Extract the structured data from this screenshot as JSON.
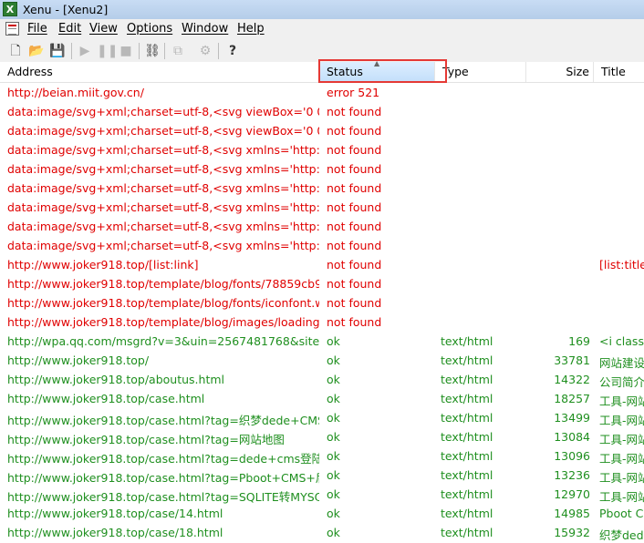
{
  "window": {
    "title": "Xenu - [Xenu2]",
    "app_icon": "x-logo-icon"
  },
  "menu": [
    "File",
    "Edit",
    "View",
    "Options",
    "Window",
    "Help"
  ],
  "toolbar": [
    "new-document-icon",
    "open-folder-icon",
    "save-icon",
    "play-icon",
    "pause-icon",
    "stop-icon",
    "binoculars-icon",
    "copy-icon",
    "properties-icon",
    "help-icon"
  ],
  "columns": {
    "address": "Address",
    "status": "Status",
    "type": "Type",
    "size": "Size",
    "title": "Title"
  },
  "rows": [
    {
      "address": "http://beian.miit.gov.cn/",
      "status": "error 521",
      "type": "",
      "size": "",
      "title": "",
      "color": "red"
    },
    {
      "address": "data:image/svg+xml;charset=utf-8,<svg viewBox='0 0 1...",
      "status": "not found",
      "type": "",
      "size": "",
      "title": "",
      "color": "red"
    },
    {
      "address": "data:image/svg+xml;charset=utf-8,<svg viewBox='0 0 1...",
      "status": "not found",
      "type": "",
      "size": "",
      "title": "",
      "color": "red"
    },
    {
      "address": "data:image/svg+xml;charset=utf-8,<svg xmlns='http://w...",
      "status": "not found",
      "type": "",
      "size": "",
      "title": "",
      "color": "red"
    },
    {
      "address": "data:image/svg+xml;charset=utf-8,<svg xmlns='http://w...",
      "status": "not found",
      "type": "",
      "size": "",
      "title": "",
      "color": "red"
    },
    {
      "address": "data:image/svg+xml;charset=utf-8,<svg xmlns='http://w...",
      "status": "not found",
      "type": "",
      "size": "",
      "title": "",
      "color": "red"
    },
    {
      "address": "data:image/svg+xml;charset=utf-8,<svg xmlns='http://w...",
      "status": "not found",
      "type": "",
      "size": "",
      "title": "",
      "color": "red"
    },
    {
      "address": "data:image/svg+xml;charset=utf-8,<svg xmlns='http://w...",
      "status": "not found",
      "type": "",
      "size": "",
      "title": "",
      "color": "red"
    },
    {
      "address": "data:image/svg+xml;charset=utf-8,<svg xmlns='http://w...",
      "status": "not found",
      "type": "",
      "size": "",
      "title": "",
      "color": "red"
    },
    {
      "address": "http://www.joker918.top/[list:link]",
      "status": "not found",
      "type": "",
      "size": "",
      "title": "[list:title]",
      "color": "red"
    },
    {
      "address": "http://www.joker918.top/template/blog/fonts/78859cb9...",
      "status": "not found",
      "type": "",
      "size": "",
      "title": "",
      "color": "red"
    },
    {
      "address": "http://www.joker918.top/template/blog/fonts/iconfont.woff",
      "status": "not found",
      "type": "",
      "size": "",
      "title": "",
      "color": "red"
    },
    {
      "address": "http://www.joker918.top/template/blog/images/loading.gif",
      "status": "not found",
      "type": "",
      "size": "",
      "title": "",
      "color": "red"
    },
    {
      "address": "http://wpa.qq.com/msgrd?v=3&uin=2567481768&site=...",
      "status": "ok",
      "type": "text/html",
      "size": "169",
      "title": " <i class",
      "color": "green"
    },
    {
      "address": "http://www.joker918.top/",
      "status": "ok",
      "type": "text/html",
      "size": "33781",
      "title": "网站建设",
      "color": "green"
    },
    {
      "address": "http://www.joker918.top/aboutus.html",
      "status": "ok",
      "type": "text/html",
      "size": "14322",
      "title": "公司简介",
      "color": "green"
    },
    {
      "address": "http://www.joker918.top/case.html",
      "status": "ok",
      "type": "text/html",
      "size": "18257",
      "title": "工具-网站",
      "color": "green"
    },
    {
      "address": "http://www.joker918.top/case.html?tag=织梦dede+CMS...",
      "status": "ok",
      "type": "text/html",
      "size": "13499",
      "title": "工具-网站",
      "color": "green"
    },
    {
      "address": "http://www.joker918.top/case.html?tag=网站地图",
      "status": "ok",
      "type": "text/html",
      "size": "13084",
      "title": "工具-网站",
      "color": "green"
    },
    {
      "address": "http://www.joker918.top/case.html?tag=dede+cms登陆...",
      "status": "ok",
      "type": "text/html",
      "size": "13096",
      "title": "工具-网站",
      "color": "green"
    },
    {
      "address": "http://www.joker918.top/case.html?tag=Pboot+CMS+后...",
      "status": "ok",
      "type": "text/html",
      "size": "13236",
      "title": "工具-网站",
      "color": "green"
    },
    {
      "address": "http://www.joker918.top/case.html?tag=SQLITE转MYSQ...",
      "status": "ok",
      "type": "text/html",
      "size": "12970",
      "title": "工具-网站",
      "color": "green"
    },
    {
      "address": "http://www.joker918.top/case/14.html",
      "status": "ok",
      "type": "text/html",
      "size": "14985",
      "title": "Pboot C",
      "color": "green"
    },
    {
      "address": "http://www.joker918.top/case/18.html",
      "status": "ok",
      "type": "text/html",
      "size": "15932",
      "title": "织梦ded",
      "color": "green"
    }
  ],
  "colors": {
    "error": "#e00000",
    "ok": "#1f8f1f",
    "highlight": "#e53935"
  }
}
